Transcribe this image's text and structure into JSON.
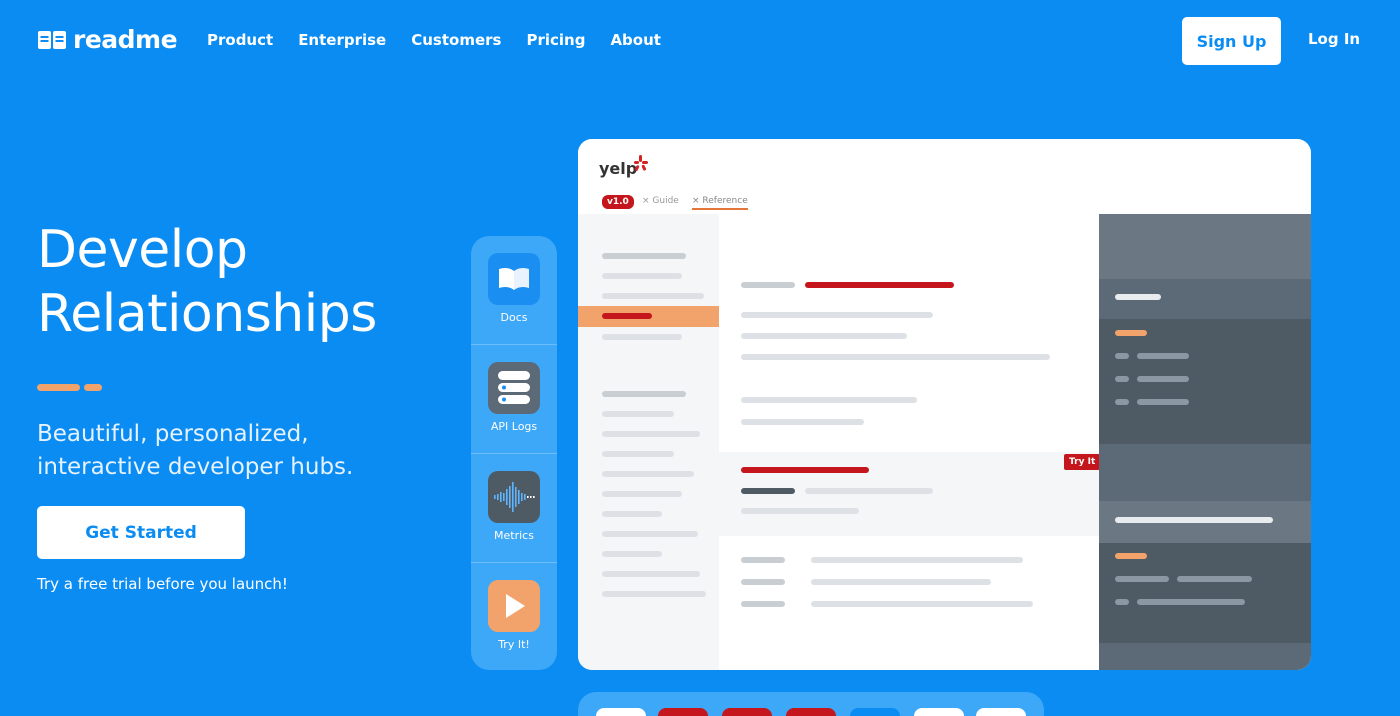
{
  "nav": {
    "logo_text": "readme",
    "links": [
      "Product",
      "Enterprise",
      "Customers",
      "Pricing",
      "About"
    ],
    "signup_label": "Sign Up",
    "login_label": "Log In"
  },
  "hero": {
    "title_line1": "Develop",
    "title_line2": "Relationships",
    "subtitle_line1": "Beautiful, personalized,",
    "subtitle_line2": "interactive developer hubs.",
    "cta_label": "Get Started",
    "trial_text": "Try a free trial before you launch!"
  },
  "features": [
    {
      "label": "Docs",
      "icon": "book-icon"
    },
    {
      "label": "API Logs",
      "icon": "logs-icon"
    },
    {
      "label": "Metrics",
      "icon": "waveform-icon"
    },
    {
      "label": "Try It!",
      "icon": "play-icon"
    }
  ],
  "mock": {
    "brand": "yelp",
    "version": "v1.0",
    "tab_guide": "Guide",
    "tab_reference": "Reference",
    "try_it": "Try It"
  },
  "colors": {
    "background": "#0a8cf3",
    "accent_orange": "#f2a36b",
    "accent_red": "#c4161c",
    "panel_dark": "#5b6a76"
  }
}
